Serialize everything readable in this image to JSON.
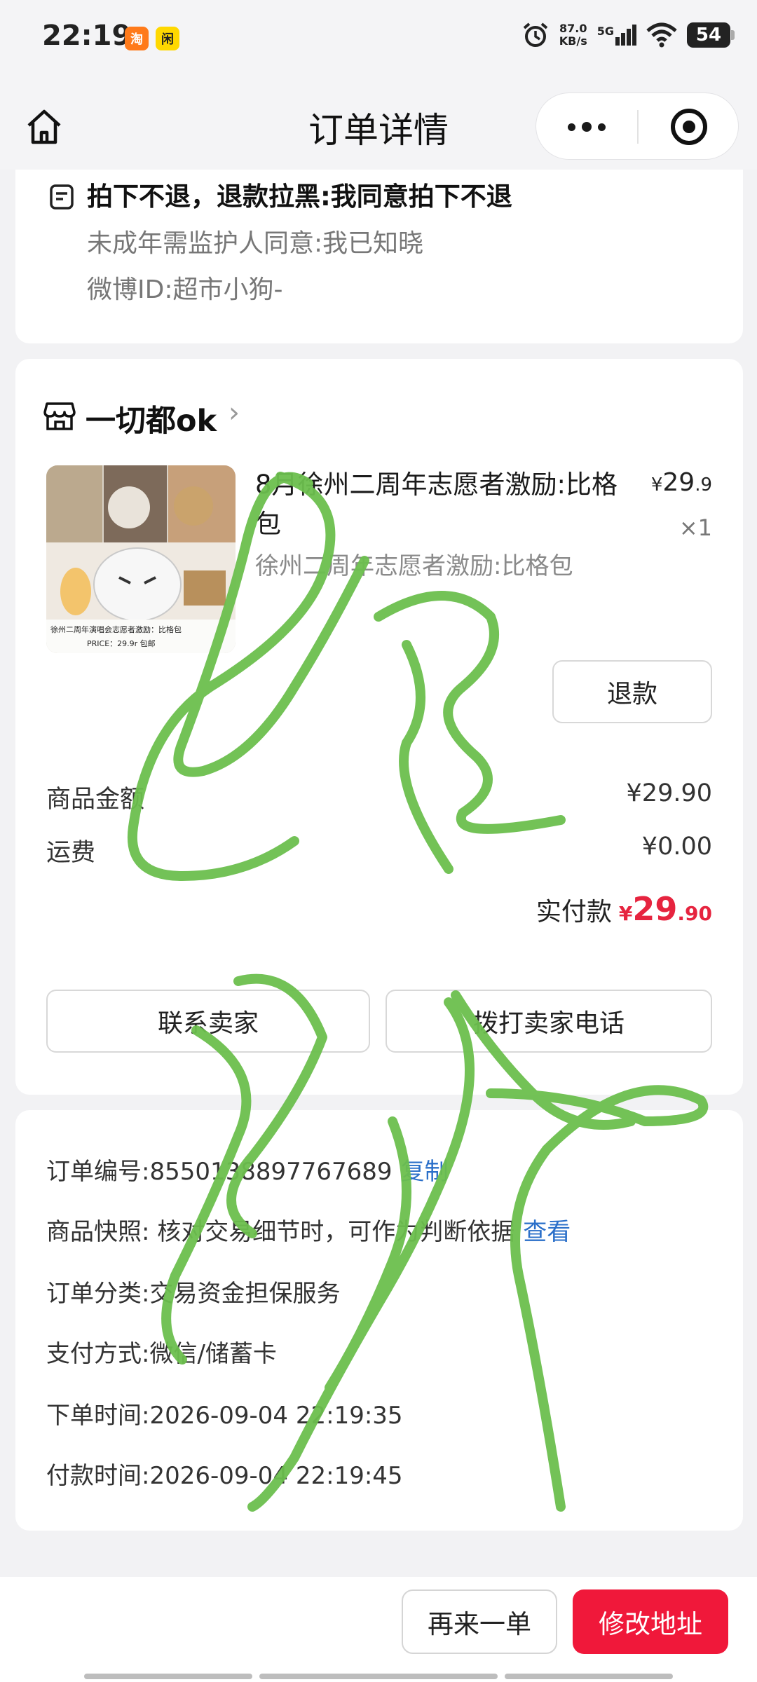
{
  "status_bar": {
    "time": "22:19",
    "net_speed_value": "87.0",
    "net_speed_unit": "KB/s",
    "network": "5G",
    "battery": "54",
    "app_badges": [
      "taobao-app-icon",
      "xianyu-app-icon"
    ]
  },
  "nav": {
    "title": "订单详情",
    "home_icon": "home-icon",
    "more_icon": "more-dots-icon",
    "close_icon": "target-close-icon"
  },
  "notes": {
    "bold_line": "拍下不退，退款拉黑:我同意拍下不退",
    "lines": [
      "未成年需监护人同意:我已知晓",
      "微博ID:超市小狗-"
    ]
  },
  "store": {
    "name": "一切都ok",
    "arrow": "›"
  },
  "product": {
    "title": "8月徐州二周年志愿者激励:比格包",
    "spec": "徐州二周年志愿者激励:比格包",
    "price_currency": "¥",
    "price_int": "29",
    "price_dec": ".9",
    "quantity": "×1",
    "refund_label": "退款",
    "image_caption_1": "徐州二周年演唱会志愿者激励：比格包",
    "image_caption_2": "PRICE：29.9r 包邮"
  },
  "amounts": {
    "goods_label": "商品金额",
    "goods_value": "¥29.90",
    "shipping_label": "运费",
    "shipping_value": "¥0.00",
    "paid_label": "实付款",
    "paid_currency": "¥",
    "paid_int": "29",
    "paid_dec": ".90"
  },
  "actions": {
    "contact_seller": "联系卖家",
    "call_seller": "拨打卖家电话"
  },
  "info": {
    "order_no": "订单编号:8550138897767689",
    "copy_label": "复制",
    "snapshot": "商品快照: 核对交易细节时，可作为判断依据",
    "view_label": "查看",
    "category": "订单分类:交易资金担保服务",
    "payment": "支付方式:微信/储蓄卡",
    "order_time": "下单时间:2026-09-04 22:19:35",
    "pay_time": "付款时间:2026-09-04 22:19:45"
  },
  "bottom": {
    "again_label": "再来一单",
    "edit_label": "修改地址"
  },
  "colors": {
    "accent_red": "#f0183a",
    "price_red": "#e6243f",
    "link_blue": "#2a6fc9",
    "signature_green": "#6cbf4e"
  }
}
